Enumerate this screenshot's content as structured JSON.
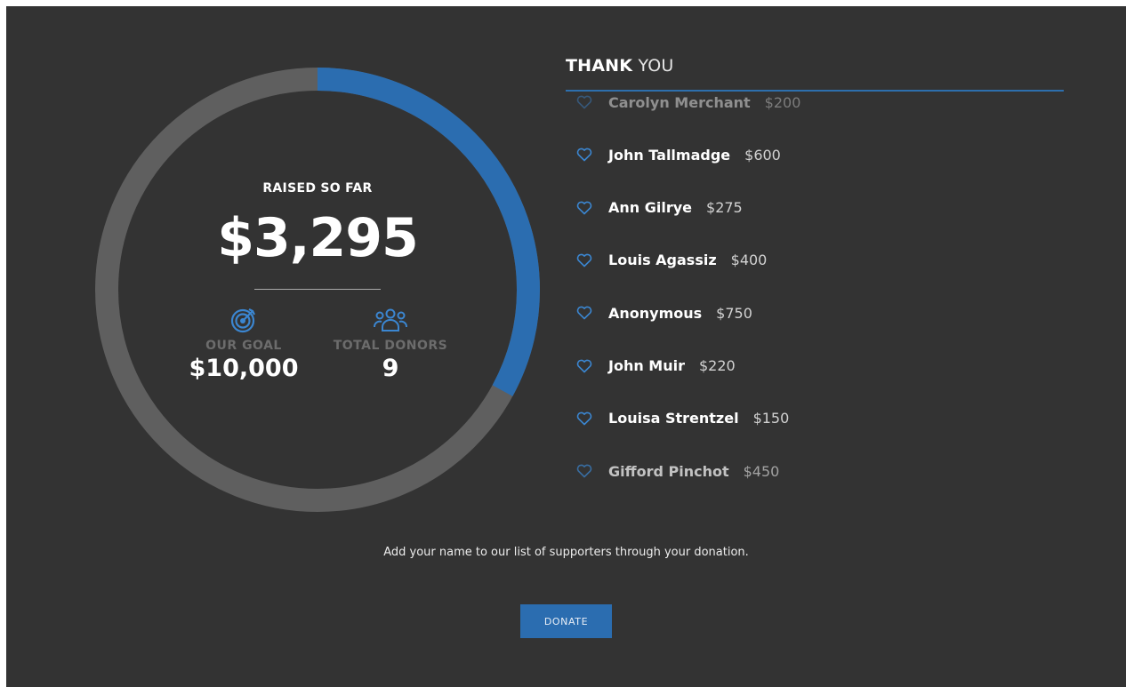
{
  "campaign": {
    "raised_label": "RAISED SO FAR",
    "raised_amount": "$3,295",
    "goal_label": "OUR GOAL",
    "goal_value": "$10,000",
    "donors_label": "TOTAL DONORS",
    "donors_value": "9",
    "progress_fraction": 0.3295,
    "goal_icon": "target-icon",
    "donors_icon": "people-icon"
  },
  "thanks": {
    "title_bold": "THANK",
    "title_light": "YOU"
  },
  "donors": [
    {
      "name": "Carolyn Merchant",
      "amount": "$200"
    },
    {
      "name": "John Tallmadge",
      "amount": "$600"
    },
    {
      "name": "Ann Gilrye",
      "amount": "$275"
    },
    {
      "name": "Louis Agassiz",
      "amount": "$400"
    },
    {
      "name": "Anonymous",
      "amount": "$750"
    },
    {
      "name": "John Muir",
      "amount": "$220"
    },
    {
      "name": "Louisa Strentzel",
      "amount": "$150"
    },
    {
      "name": "Gifford Pinchot",
      "amount": "$450"
    }
  ],
  "cta": {
    "message": "Add your name to our list of supporters through your donation.",
    "button_label": "DONATE"
  },
  "colors": {
    "background": "#333333",
    "ring_track": "#5f5f5f",
    "accent": "#2b6db0",
    "icon_blue": "#3b86d1"
  }
}
